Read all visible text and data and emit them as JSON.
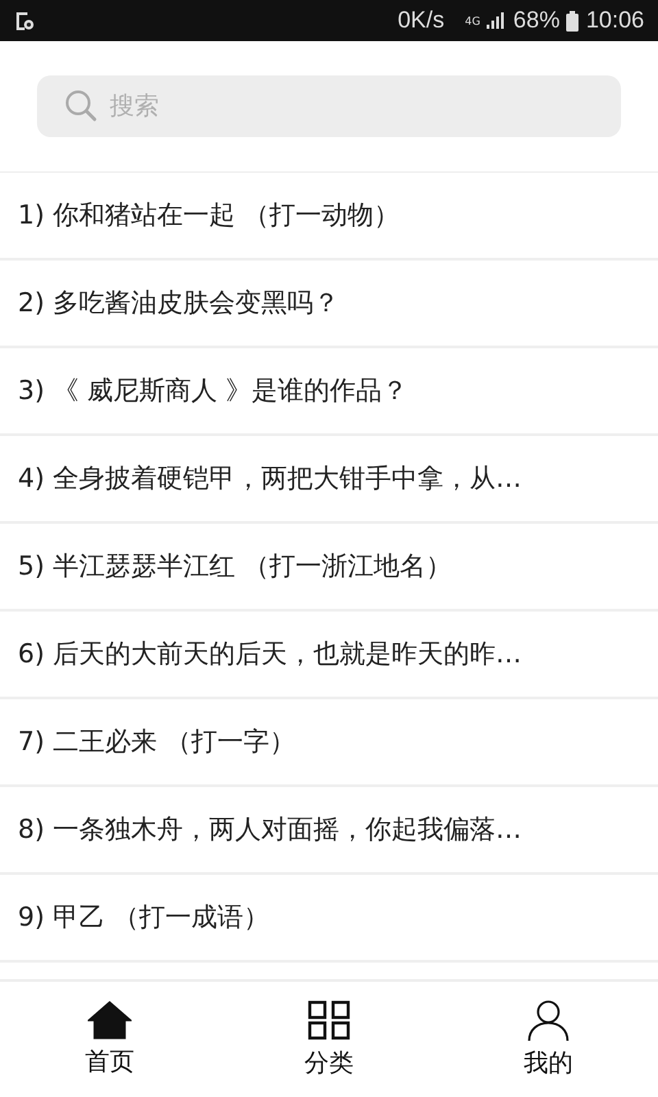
{
  "status_bar": {
    "speed": "0K/s",
    "network": "4G",
    "battery": "68%",
    "time": "10:06"
  },
  "search": {
    "placeholder": "搜索"
  },
  "riddles": [
    {
      "text": "1) 你和猪站在一起 （打一动物）"
    },
    {
      "text": "2) 多吃酱油皮肤会变黑吗？"
    },
    {
      "text": "3) 《 威尼斯商人 》是谁的作品？"
    },
    {
      "text": "4) 全身披着硬铠甲，两把大钳手中拿，从…"
    },
    {
      "text": "5) 半江瑟瑟半江红 （打一浙江地名）"
    },
    {
      "text": "6) 后天的大前天的后天，也就是昨天的昨…"
    },
    {
      "text": "7) 二王必来 （打一字）"
    },
    {
      "text": "8) 一条独木舟，两人对面摇，你起我偏落…"
    },
    {
      "text": "9) 甲乙 （打一成语）"
    }
  ],
  "tabs": [
    {
      "kind": "home",
      "label": "首页",
      "selected": true
    },
    {
      "kind": "grid",
      "label": "分类",
      "selected": false
    },
    {
      "kind": "person",
      "label": "我的",
      "selected": false
    }
  ]
}
